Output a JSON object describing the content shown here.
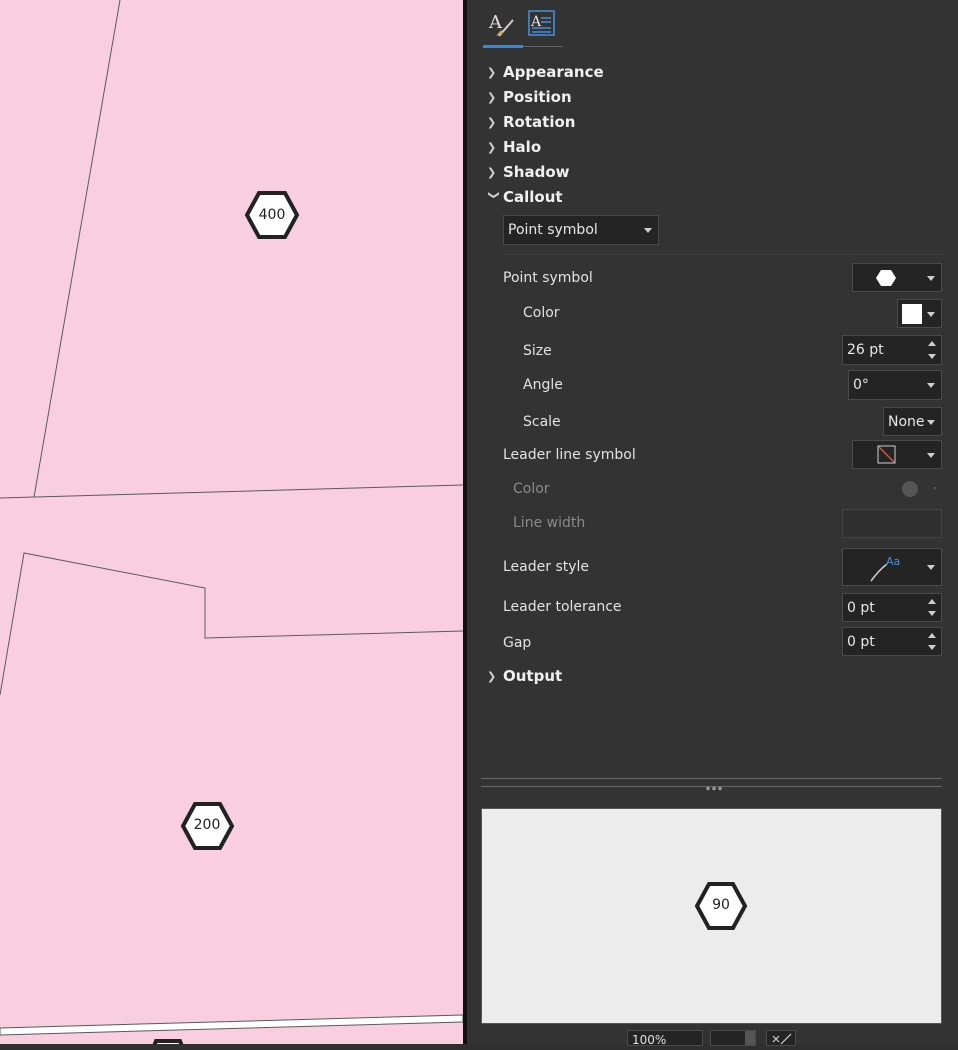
{
  "map": {
    "labels": [
      "400",
      "200"
    ],
    "fill_color": "#f9cfe0",
    "line_color": "#5a5a5a"
  },
  "panel": {
    "tabs": [
      {
        "name": "symbol-tab",
        "icon": "paintbrush-text-icon",
        "active": true
      },
      {
        "name": "text-tab",
        "icon": "text-paragraph-icon",
        "active": false
      }
    ],
    "sections": {
      "appearance": "Appearance",
      "position": "Position",
      "rotation": "Rotation",
      "halo": "Halo",
      "shadow": "Shadow",
      "callout": "Callout",
      "output": "Output"
    },
    "callout": {
      "type_value": "Point symbol",
      "point_symbol_label": "Point symbol",
      "color_label": "Color",
      "size_label": "Size",
      "size_value": "26 pt",
      "angle_label": "Angle",
      "angle_value": "0°",
      "scale_label": "Scale",
      "scale_value": "None",
      "leader_line_symbol_label": "Leader line symbol",
      "leader_color_label": "Color",
      "line_width_label": "Line width",
      "leader_style_label": "Leader style",
      "leader_tolerance_label": "Leader tolerance",
      "leader_tolerance_value": "0 pt",
      "gap_label": "Gap",
      "gap_value": "0 pt"
    },
    "preview": {
      "label": "90"
    },
    "bottom": {
      "zoom_value": "100%"
    },
    "colors": {
      "accent": "#2d8ae6",
      "panel_bg": "#333333",
      "symbol_color": "#ffffff"
    }
  }
}
